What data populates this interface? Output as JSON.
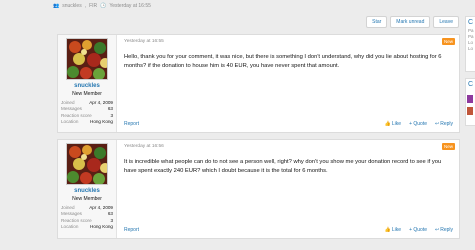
{
  "thread_meta": {
    "author": "snuckles",
    "edited": "FIR",
    "time": "Yesterday at 16:55"
  },
  "toolbar": {
    "star": "Star",
    "mark_unread": "Mark unread",
    "leave": "Leave"
  },
  "posts": [
    {
      "username": "snuckles",
      "user_title": "New Member",
      "stats": [
        {
          "k": "Joined",
          "v": "Apr 4, 2009"
        },
        {
          "k": "Messages",
          "v": "63"
        },
        {
          "k": "Reaction score",
          "v": "3"
        },
        {
          "k": "Location",
          "v": "Hong Kong"
        }
      ],
      "date": "Yesterday at 16:55",
      "badge": "New",
      "text": "Hello, thank you for your comment, it was nice, but there is something I don't understand, why did you lie about hosting for 6 months? if the donation to house him is 40 EUR, you have never spent that amount.",
      "report": "Report",
      "like": "Like",
      "quote": "+ Quote",
      "reply": "Reply"
    },
    {
      "username": "snuckles",
      "user_title": "New Member",
      "stats": [
        {
          "k": "Joined",
          "v": "Apr 4, 2009"
        },
        {
          "k": "Messages",
          "v": "63"
        },
        {
          "k": "Reaction score",
          "v": "3"
        },
        {
          "k": "Location",
          "v": "Hong Kong"
        }
      ],
      "date": "Yesterday at 16:56",
      "badge": "New",
      "text": "It is incredible what people can do to not see a person well, right? why don't you show me your donation record to see if you have spent exactly 240 EUR? which I doubt because it is the total for 6 months.",
      "report": "Report",
      "like": "Like",
      "quote": "+ Quote",
      "reply": "Reply"
    }
  ],
  "sidebar": {
    "box1_initial": "C",
    "box1_lines": [
      "Pa",
      "Pa",
      "Lo",
      "Lo"
    ],
    "box2_initial": "C"
  },
  "colors": {
    "link": "#2577b1",
    "new_badge": "#f7931e",
    "muted": "#8c8c8c"
  }
}
